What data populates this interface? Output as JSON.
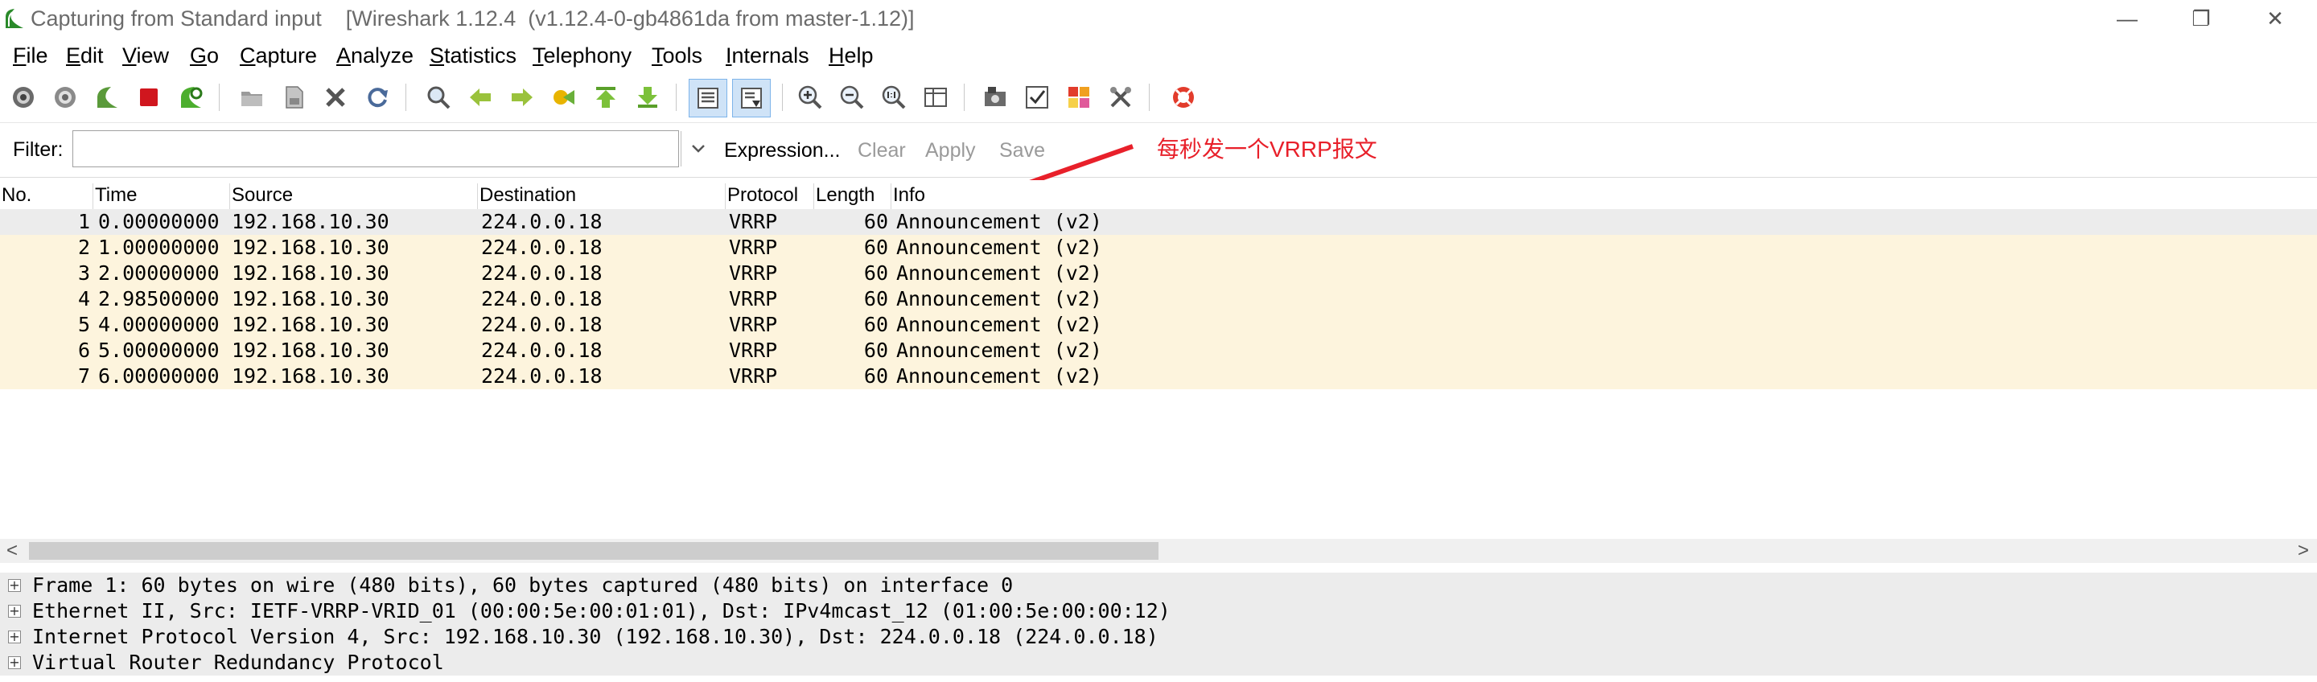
{
  "window": {
    "title": "Capturing from Standard input    [Wireshark 1.12.4  (v1.12.4-0-gb4861da from master-1.12)]",
    "minimize_glyph": "—",
    "restore_glyph": "❐",
    "close_glyph": "✕"
  },
  "menu": [
    "File",
    "Edit",
    "View",
    "Go",
    "Capture",
    "Analyze",
    "Statistics",
    "Telephony",
    "Tools",
    "Internals",
    "Help"
  ],
  "filter": {
    "label": "Filter:",
    "value": "",
    "expression": "Expression...",
    "clear": "Clear",
    "apply": "Apply",
    "save": "Save"
  },
  "annotation": {
    "text": "每秒发一个VRRP报文",
    "color": "#e8202a"
  },
  "columns": {
    "no": "No.",
    "time": "Time",
    "source": "Source",
    "destination": "Destination",
    "protocol": "Protocol",
    "length": "Length",
    "info": "Info"
  },
  "packets": [
    {
      "no": "1",
      "time": "0.00000000",
      "source": "192.168.10.30",
      "destination": "224.0.0.18",
      "protocol": "VRRP",
      "length": "60",
      "info": "Announcement (v2)"
    },
    {
      "no": "2",
      "time": "1.00000000",
      "source": "192.168.10.30",
      "destination": "224.0.0.18",
      "protocol": "VRRP",
      "length": "60",
      "info": "Announcement (v2)"
    },
    {
      "no": "3",
      "time": "2.00000000",
      "source": "192.168.10.30",
      "destination": "224.0.0.18",
      "protocol": "VRRP",
      "length": "60",
      "info": "Announcement (v2)"
    },
    {
      "no": "4",
      "time": "2.98500000",
      "source": "192.168.10.30",
      "destination": "224.0.0.18",
      "protocol": "VRRP",
      "length": "60",
      "info": "Announcement (v2)"
    },
    {
      "no": "5",
      "time": "4.00000000",
      "source": "192.168.10.30",
      "destination": "224.0.0.18",
      "protocol": "VRRP",
      "length": "60",
      "info": "Announcement (v2)"
    },
    {
      "no": "6",
      "time": "5.00000000",
      "source": "192.168.10.30",
      "destination": "224.0.0.18",
      "protocol": "VRRP",
      "length": "60",
      "info": "Announcement (v2)"
    },
    {
      "no": "7",
      "time": "6.00000000",
      "source": "192.168.10.30",
      "destination": "224.0.0.18",
      "protocol": "VRRP",
      "length": "60",
      "info": "Announcement (v2)"
    }
  ],
  "row_colors": {
    "selected": "#ececec",
    "vrrp": "#fdf4dd"
  },
  "details": [
    "Frame 1: 60 bytes on wire (480 bits), 60 bytes captured (480 bits) on interface 0",
    "Ethernet II, Src: IETF-VRRP-VRID_01 (00:00:5e:00:01:01), Dst: IPv4mcast_12 (01:00:5e:00:00:12)",
    "Internet Protocol Version 4, Src: 192.168.10.30 (192.168.10.30), Dst: 224.0.0.18 (224.0.0.18)",
    "Virtual Router Redundancy Protocol"
  ],
  "scroll": {
    "left_arrow": "<",
    "right_arrow": ">"
  }
}
